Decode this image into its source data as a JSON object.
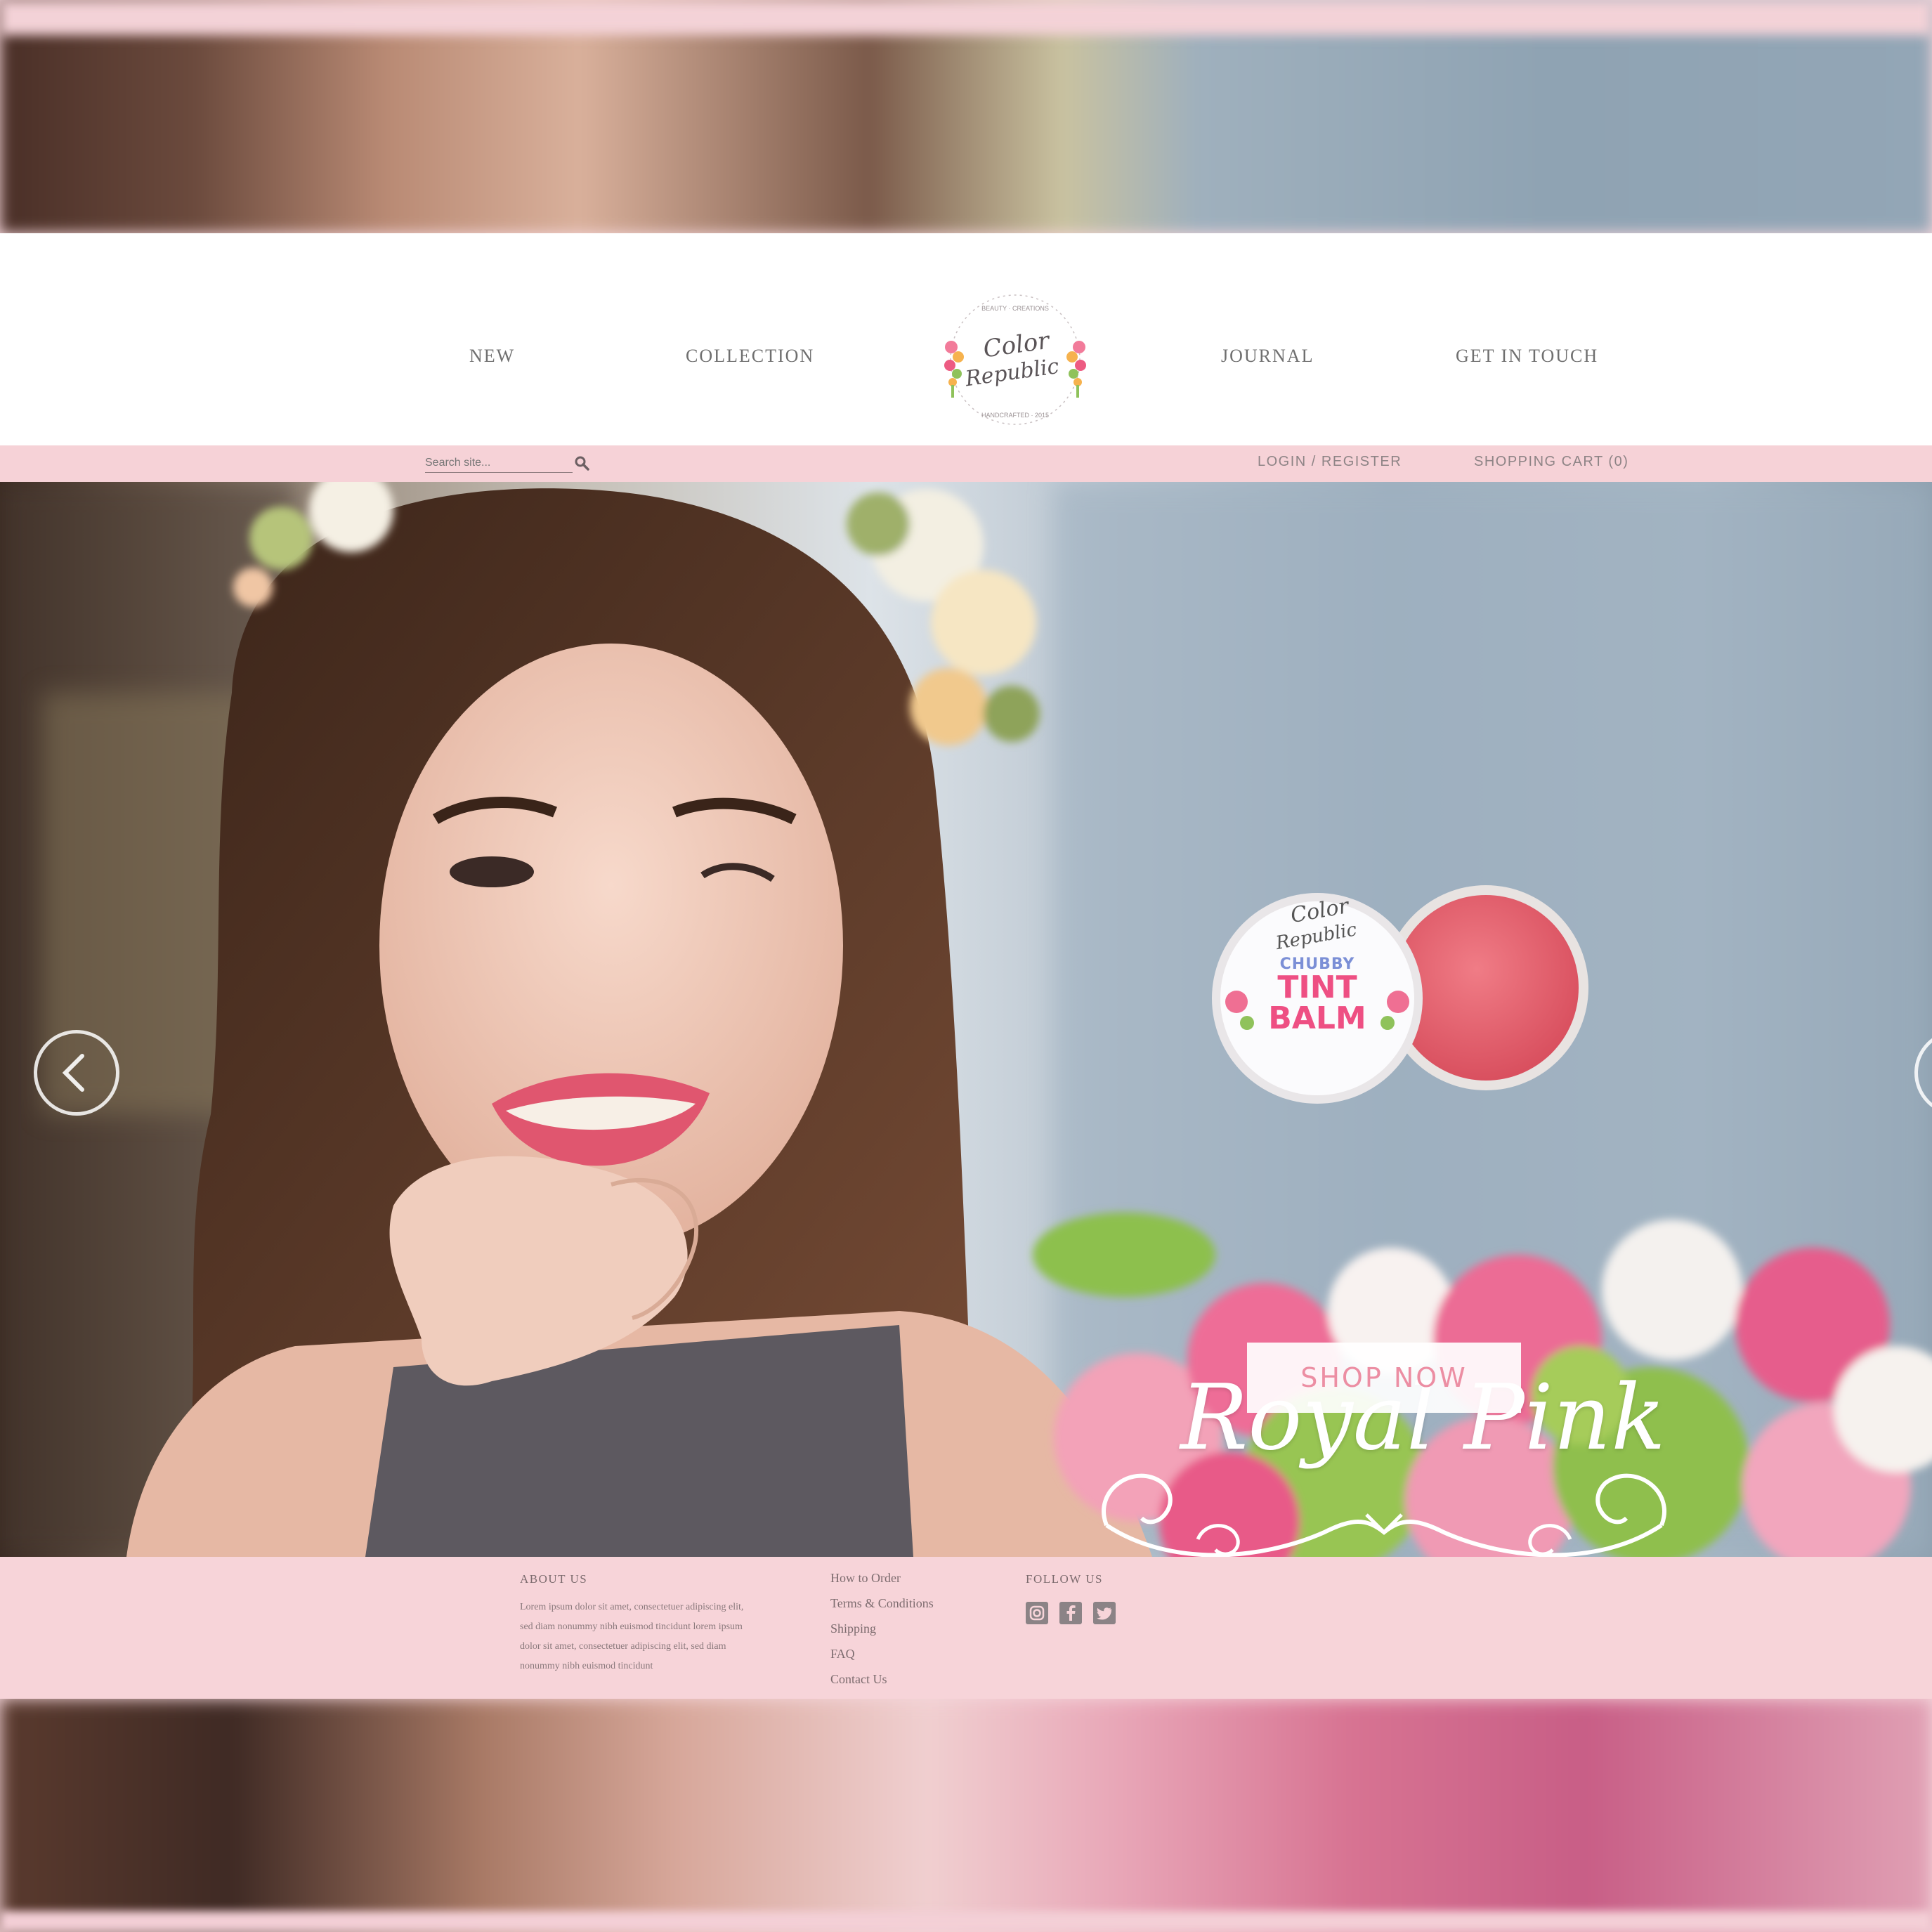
{
  "header": {
    "nav": [
      "NEW",
      "COLLECTION",
      "JOURNAL",
      "GET IN TOUCH"
    ],
    "logo_text": "Color Republic"
  },
  "utility": {
    "search_placeholder": "Search site...",
    "login": "LOGIN / REGISTER",
    "cart": "SHOPPING CART (0)"
  },
  "hero": {
    "product_line1": "CHUBBY",
    "product_line2": "TINT",
    "product_line3": "BALM",
    "title": "Royal Pink",
    "cta": "SHOP NOW"
  },
  "footer": {
    "about_heading": "ABOUT US",
    "about_text": "Lorem ipsum dolor sit amet, consectetuer adipiscing elit, sed diam nonummy nibh euismod tincidunt lorem ipsum dolor sit amet, consectetuer adipiscing elit, sed diam nonummy nibh euismod tincidunt",
    "links": [
      "How to Order",
      "Terms & Conditions",
      "Shipping",
      "FAQ",
      "Contact Us"
    ],
    "follow_heading": "FOLLOW US",
    "social": [
      "instagram-icon",
      "facebook-icon",
      "twitter-icon"
    ]
  },
  "colors": {
    "accent_pink": "#f6d2d7",
    "button_text": "#ec8ea3"
  }
}
